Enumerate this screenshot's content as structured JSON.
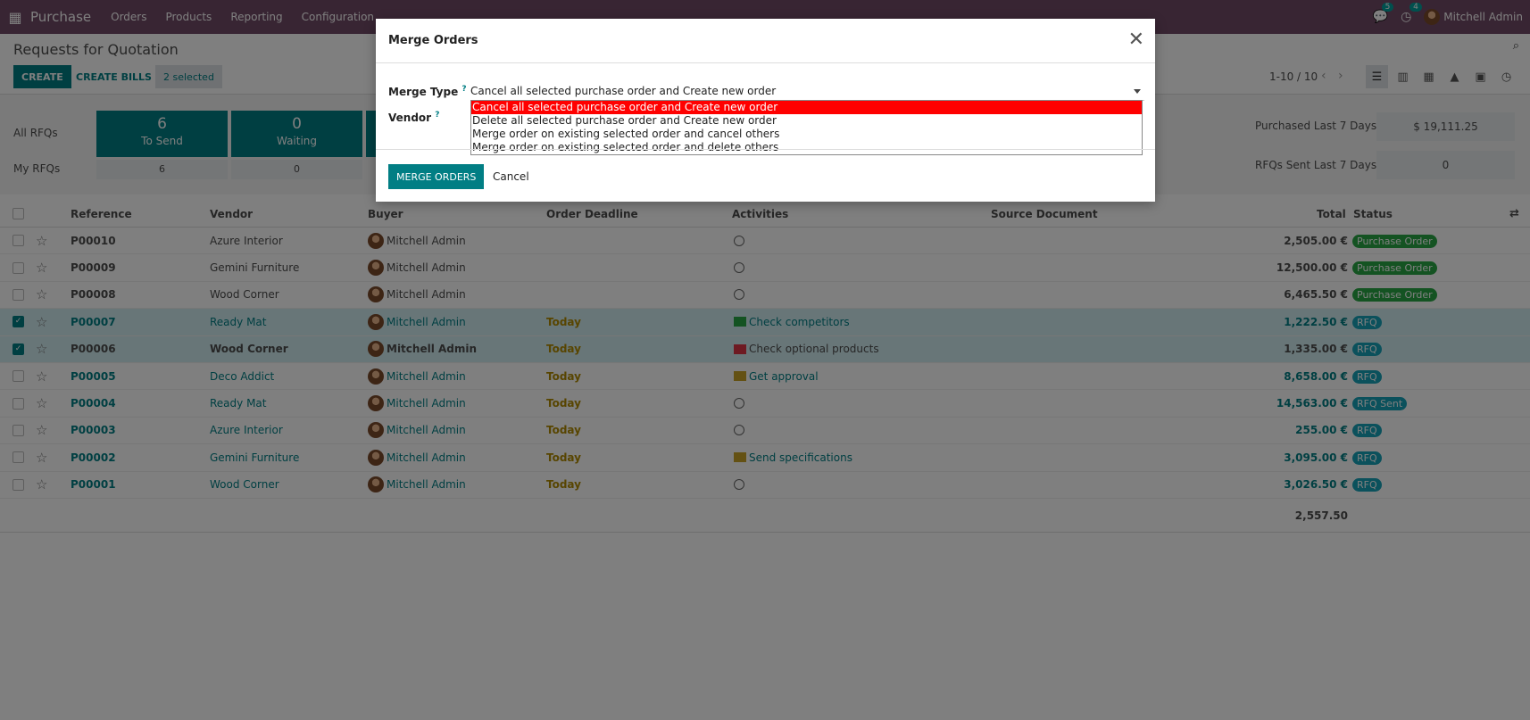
{
  "topbar": {
    "app_name": "Purchase",
    "menus": [
      "Orders",
      "Products",
      "Reporting",
      "Configuration"
    ],
    "chat_badge": "5",
    "activity_badge": "4",
    "user_name": "Mitchell Admin"
  },
  "control_panel": {
    "breadcrumb": "Requests for Quotation",
    "create_label": "CREATE",
    "create_bills_label": "CREATE BILLS",
    "selected_label": "2 selected",
    "pager": "1-10 / 10"
  },
  "dashboard": {
    "row_labels": [
      "All RFQs",
      "My RFQs"
    ],
    "tiles": [
      {
        "count": "6",
        "label": "To Send",
        "my": "6"
      },
      {
        "count": "0",
        "label": "Waiting",
        "my": "0"
      }
    ],
    "stats": [
      {
        "label": "Purchased Last 7 Days",
        "value": "$ 19,111.25"
      },
      {
        "label": "RFQs Sent Last 7 Days",
        "value": "0"
      }
    ]
  },
  "table": {
    "columns": [
      "Reference",
      "Vendor",
      "Buyer",
      "Order Deadline",
      "Activities",
      "Source Document",
      "Total",
      "Status"
    ],
    "rows": [
      {
        "ref": "P00010",
        "vendor": "Azure Interior",
        "buyer": "Mitchell Admin",
        "deadline": "",
        "activity": "",
        "act_icon": "clock-icon",
        "total": "2,505.00 €",
        "status": "Purchase Order",
        "checked": false,
        "style": "plain"
      },
      {
        "ref": "P00009",
        "vendor": "Gemini Furniture",
        "buyer": "Mitchell Admin",
        "deadline": "",
        "activity": "",
        "act_icon": "clock-icon",
        "total": "12,500.00 €",
        "status": "Purchase Order",
        "checked": false,
        "style": "plain"
      },
      {
        "ref": "P00008",
        "vendor": "Wood Corner",
        "buyer": "Mitchell Admin",
        "deadline": "",
        "activity": "",
        "act_icon": "clock-icon",
        "total": "6,465.50 €",
        "status": "Purchase Order",
        "checked": false,
        "style": "plain"
      },
      {
        "ref": "P00007",
        "vendor": "Ready Mat",
        "buyer": "Mitchell Admin",
        "deadline": "Today",
        "activity": "Check competitors",
        "act_icon": "table-icon",
        "total": "1,222.50 €",
        "status": "RFQ",
        "checked": true,
        "style": "teal"
      },
      {
        "ref": "P00006",
        "vendor": "Wood Corner",
        "buyer": "Mitchell Admin",
        "deadline": "Today",
        "activity": "Check optional products",
        "act_icon": "table-icon",
        "total": "1,335.00 €",
        "status": "RFQ",
        "checked": true,
        "style": "bold"
      },
      {
        "ref": "P00005",
        "vendor": "Deco Addict",
        "buyer": "Mitchell Admin",
        "deadline": "Today",
        "activity": "Get approval",
        "act_icon": "table-icon",
        "total": "8,658.00 €",
        "status": "RFQ",
        "checked": false,
        "style": "teal"
      },
      {
        "ref": "P00004",
        "vendor": "Ready Mat",
        "buyer": "Mitchell Admin",
        "deadline": "Today",
        "activity": "",
        "act_icon": "clock-icon",
        "total": "14,563.00 €",
        "status": "RFQ Sent",
        "checked": false,
        "style": "teal"
      },
      {
        "ref": "P00003",
        "vendor": "Azure Interior",
        "buyer": "Mitchell Admin",
        "deadline": "Today",
        "activity": "",
        "act_icon": "clock-icon",
        "total": "255.00 €",
        "status": "RFQ",
        "checked": false,
        "style": "teal"
      },
      {
        "ref": "P00002",
        "vendor": "Gemini Furniture",
        "buyer": "Mitchell Admin",
        "deadline": "Today",
        "activity": "Send specifications",
        "act_icon": "envelope-icon",
        "total": "3,095.00 €",
        "status": "RFQ",
        "checked": false,
        "style": "teal"
      },
      {
        "ref": "P00001",
        "vendor": "Wood Corner",
        "buyer": "Mitchell Admin",
        "deadline": "Today",
        "activity": "",
        "act_icon": "clock-icon",
        "total": "3,026.50 €",
        "status": "RFQ",
        "checked": false,
        "style": "teal"
      }
    ],
    "sum_total": "2,557.50"
  },
  "modal": {
    "title": "Merge Orders",
    "merge_type_label": "Merge Type",
    "vendor_label": "Vendor",
    "help_mark": "?",
    "merge_type_value": "Cancel all selected purchase order and Create new order",
    "options": [
      "Cancel all selected purchase order and Create new order",
      "Delete all selected purchase order and Create new order",
      "Merge order on existing selected order and cancel others",
      "Merge order on existing selected order and delete others"
    ],
    "merge_button": "MERGE ORDERS",
    "cancel_button": "Cancel"
  },
  "colors": {
    "brand": "#714b67",
    "primary": "#017e84",
    "highlight": "#ff0000"
  }
}
